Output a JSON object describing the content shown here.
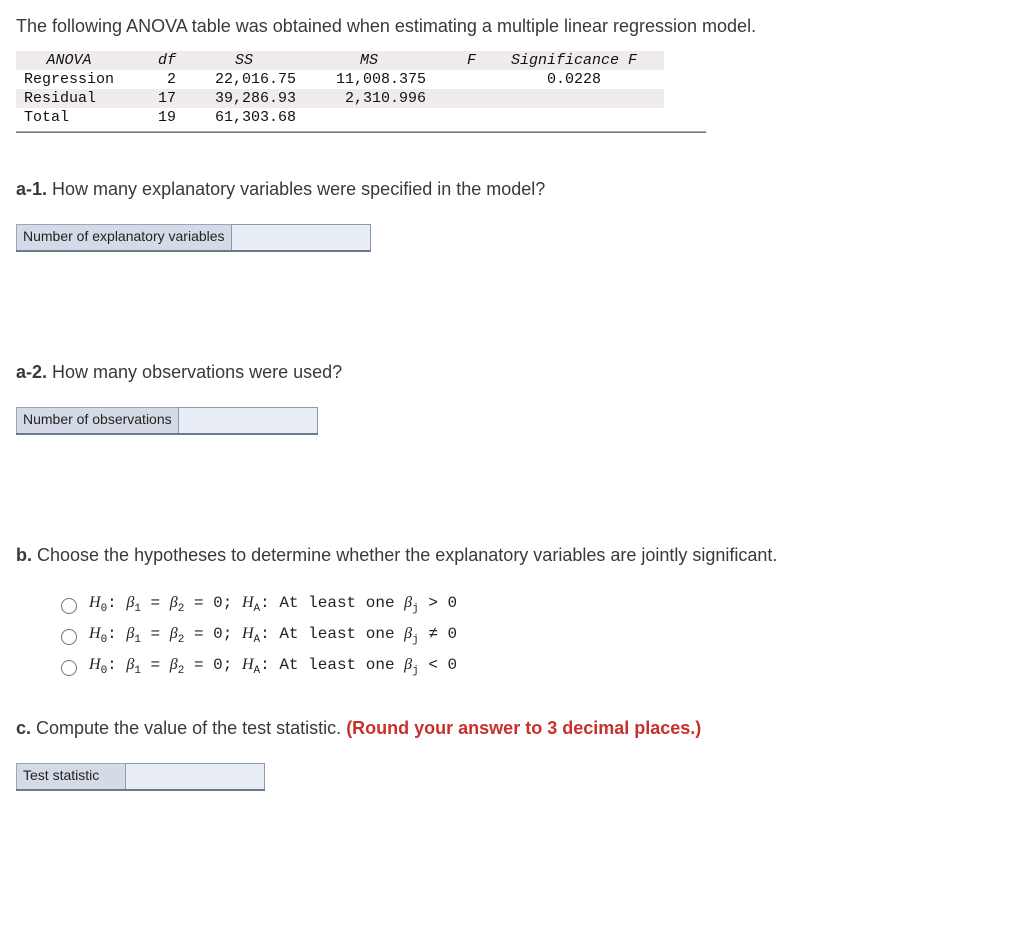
{
  "intro": "The following ANOVA table was obtained when estimating a multiple linear regression model.",
  "anova": {
    "headers": {
      "c0": "ANOVA",
      "c1": "df",
      "c2": "SS",
      "c3": "MS",
      "c4": "F",
      "c5": "Significance F"
    },
    "rows": [
      {
        "label": "Regression",
        "df": "2",
        "ss": "22,016.75",
        "ms": "11,008.375",
        "f": "",
        "sig": "0.0228"
      },
      {
        "label": "Residual",
        "df": "17",
        "ss": "39,286.93",
        "ms": "2,310.996",
        "f": "",
        "sig": ""
      },
      {
        "label": "Total",
        "df": "19",
        "ss": "61,303.68",
        "ms": "",
        "f": "",
        "sig": ""
      }
    ]
  },
  "q_a1": {
    "label_bold": "a-1.",
    "label_rest": " How many explanatory variables were specified in the model?",
    "input_label": "Number of explanatory variables",
    "value": ""
  },
  "q_a2": {
    "label_bold": "a-2.",
    "label_rest": " How many observations were used?",
    "input_label": "Number of observations",
    "value": ""
  },
  "q_b": {
    "label_bold": "b.",
    "label_rest": " Choose the hypotheses to determine whether the explanatory variables are jointly significant.",
    "options": [
      {
        "h0_pre": "H",
        "h0_sub": "0",
        "mid": ": ",
        "b1": "β",
        "b1s": "1",
        "eq": " = ",
        "b2": "β",
        "b2s": "2",
        "eq2": " = 0; ",
        "ha_pre": "H",
        "ha_sub": "A",
        "tail": ": At least one ",
        "bj": "β",
        "bjs": "j",
        "cmp": " > 0"
      },
      {
        "h0_pre": "H",
        "h0_sub": "0",
        "mid": ": ",
        "b1": "β",
        "b1s": "1",
        "eq": " = ",
        "b2": "β",
        "b2s": "2",
        "eq2": " = 0; ",
        "ha_pre": "H",
        "ha_sub": "A",
        "tail": ": At least one ",
        "bj": "β",
        "bjs": "j",
        "cmp": " ≠ 0"
      },
      {
        "h0_pre": "H",
        "h0_sub": "0",
        "mid": ": ",
        "b1": "β",
        "b1s": "1",
        "eq": " = ",
        "b2": "β",
        "b2s": "2",
        "eq2": " = 0; ",
        "ha_pre": "H",
        "ha_sub": "A",
        "tail": ": At least one ",
        "bj": "β",
        "bjs": "j",
        "cmp": " < 0"
      }
    ]
  },
  "q_c": {
    "label_bold": "c.",
    "label_rest": " Compute the value of the test statistic. ",
    "hint": "(Round your answer to 3 decimal places.)",
    "input_label": "Test statistic",
    "value": ""
  }
}
